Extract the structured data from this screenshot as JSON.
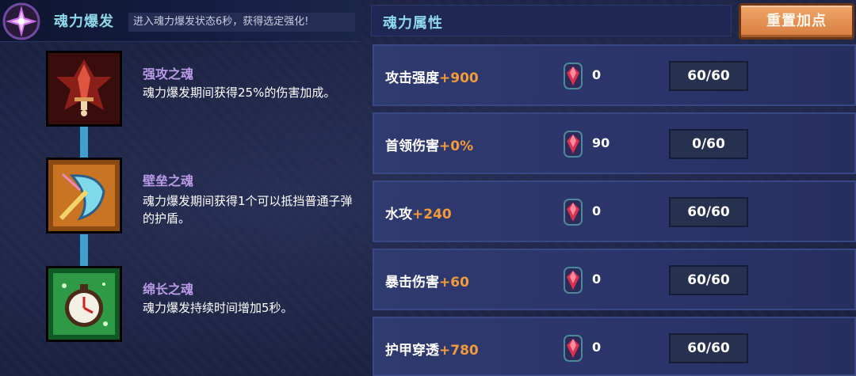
{
  "header": {
    "title": "魂力爆发",
    "subtitle": "进入魂力爆发状态6秒，获得选定强化!"
  },
  "skills": [
    {
      "name": "强攻之魂",
      "desc": "魂力爆发期间获得25%的伤害加成。",
      "icon": "sword-soul-icon",
      "color": "#c43a2d"
    },
    {
      "name": "壁垒之魂",
      "desc": "魂力爆发期间获得1个可以抵挡普通子弹的护盾。",
      "icon": "shield-soul-icon",
      "color": "#e08a2a"
    },
    {
      "name": "绵长之魂",
      "desc": "魂力爆发持续时间增加5秒。",
      "icon": "clock-soul-icon",
      "color": "#3fb657"
    }
  ],
  "attributes": {
    "title": "魂力属性",
    "reset_label": "重置加点",
    "rows": [
      {
        "label": "攻击强度",
        "bonus": "+900",
        "gems": "0",
        "points": "60/60"
      },
      {
        "label": "首领伤害",
        "bonus": "+0%",
        "gems": "90",
        "points": "0/60"
      },
      {
        "label": "水攻",
        "bonus": "+240",
        "gems": "0",
        "points": "60/60"
      },
      {
        "label": "暴击伤害",
        "bonus": "+60",
        "gems": "0",
        "points": "60/60"
      },
      {
        "label": "护甲穿透",
        "bonus": "+780",
        "gems": "0",
        "points": "60/60"
      }
    ]
  },
  "colors": {
    "accent": "#8fd8ea",
    "bonus": "#f39a3b",
    "button": "#e0914f"
  }
}
